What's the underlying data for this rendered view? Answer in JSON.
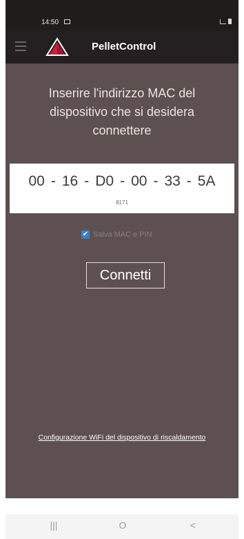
{
  "status_bar": {
    "time": "14:50",
    "right_icons": [
      "signal-icon",
      "battery-icon"
    ]
  },
  "toolbar": {
    "menu_icon": "hamburger-menu-icon",
    "logo_icon": "pelletcontrol-logo-icon",
    "title": "PelletControl"
  },
  "main": {
    "instructions": "Inserire l'indirizzo MAC del\ndispositivo che si desidera\nconnettere",
    "mac": [
      "00",
      "16",
      "D0",
      "00",
      "33",
      "5A"
    ],
    "mac_separator": "-",
    "pin": "8171",
    "save_checkbox": {
      "label": "Salva MAC e PIN",
      "checked": true
    },
    "connect_label": "Connetti",
    "wifi_link": "Configurazione WiFi del dispositivo di riscaldamento"
  },
  "nav_bar": {
    "recent": "|||",
    "home": "O",
    "back": "<"
  },
  "colors": {
    "background": "#5e5050",
    "toolbar": "#241f20",
    "logo_red": "#d01e3b",
    "checkbox": "#3b7fc4"
  }
}
